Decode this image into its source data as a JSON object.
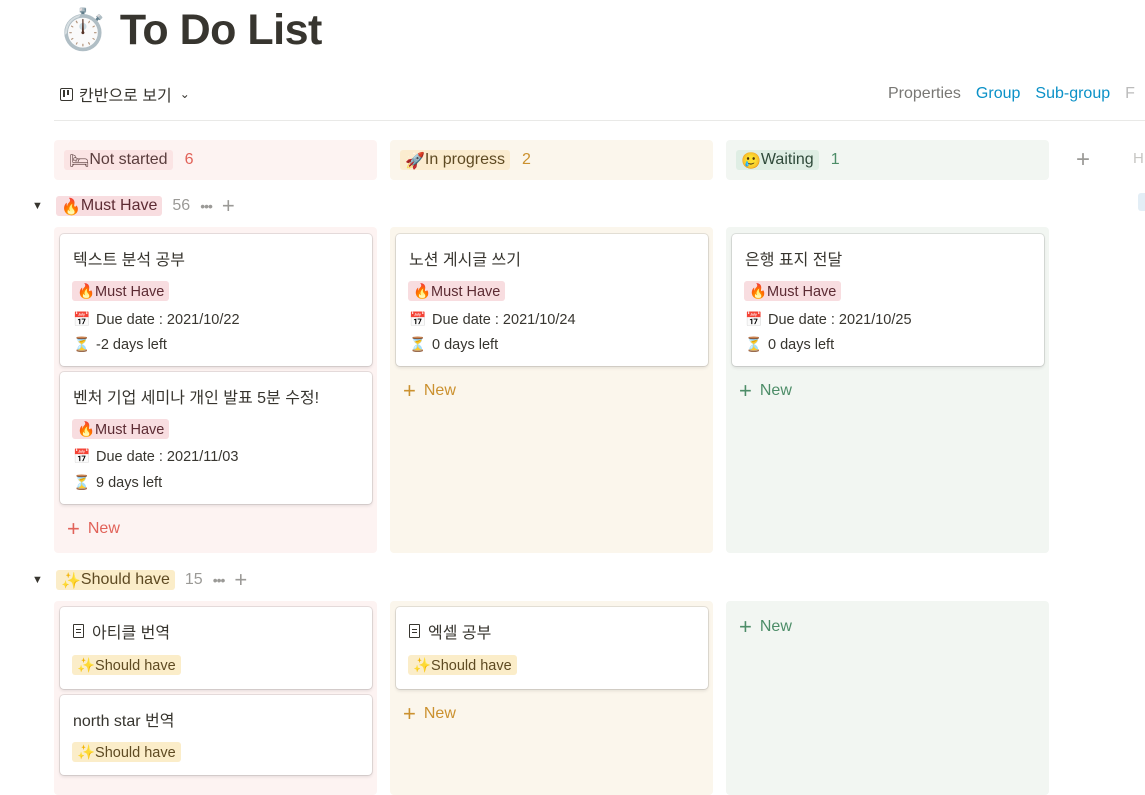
{
  "title": {
    "emoji": "⏱️",
    "text": "To Do List"
  },
  "toolbar": {
    "view_label": "칸반으로 보기",
    "properties": "Properties",
    "group": "Group",
    "subgroup": "Sub-group",
    "cut_letter": "F"
  },
  "columns": [
    {
      "emoji": "🛏",
      "label": "Not started",
      "count": "6"
    },
    {
      "emoji": "🚀",
      "label": "In progress",
      "count": "2"
    },
    {
      "emoji": "🥲",
      "label": "Waiting",
      "count": "1"
    }
  ],
  "hidden_label": "H",
  "groups": [
    {
      "emoji": "🔥",
      "label": "Must Have",
      "count": "56"
    },
    {
      "emoji": "✨",
      "label": "Should have",
      "count": "15"
    }
  ],
  "new_label": "New",
  "cards": {
    "must_notstarted_1": {
      "title": "텍스트 분석 공부",
      "tag": "🔥Must Have",
      "due": "Due date : 2021/10/22",
      "left": "-2 days left"
    },
    "must_notstarted_2": {
      "title": "벤처 기업 세미나 개인 발표 5분 수정!",
      "tag": "🔥Must Have",
      "due": "Due date : 2021/11/03",
      "left": "9 days left"
    },
    "must_progress_1": {
      "title": "노션 게시글 쓰기",
      "tag": "🔥Must Have",
      "due": "Due date : 2021/10/24",
      "left": "0 days left"
    },
    "must_waiting_1": {
      "title": "은행 표지 전달",
      "tag": "🔥Must Have",
      "due": "Due date : 2021/10/25",
      "left": "0 days left"
    },
    "should_notstarted_1": {
      "title": "아티클 번역",
      "tag": "✨Should have"
    },
    "should_notstarted_2": {
      "title": "north star 번역",
      "tag": "✨Should have"
    },
    "should_progress_1": {
      "title": "엑셀 공부",
      "tag": "✨Should have"
    }
  },
  "icons": {
    "calendar": "📅",
    "hourglass": "⏳"
  },
  "colors": {
    "notstarted_lane": "#fdf3f2",
    "progress_lane": "#fbf6ec",
    "waiting_lane": "#f2f6f2",
    "notstarted_accent": "#e16259",
    "progress_accent": "#cb912f",
    "waiting_accent": "#4d8d68",
    "link": "#0b91c7"
  }
}
